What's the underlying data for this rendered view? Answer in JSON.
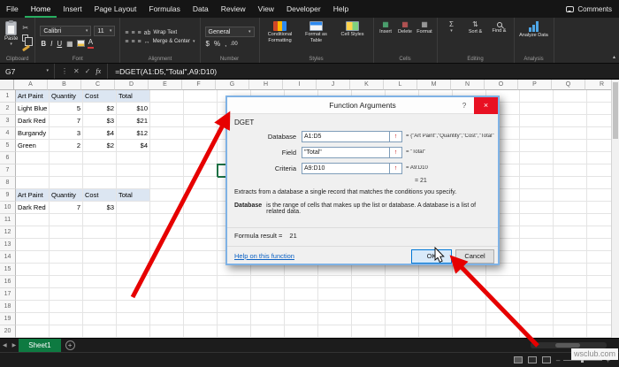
{
  "icons": {
    "dropdown": "▾",
    "close_x": "×",
    "check": "✓",
    "cancel_x": "✕",
    "fx": "fx",
    "kebab": "⋮",
    "scissors": "✂",
    "sigma": "Σ",
    "align_lines": "≡",
    "dollar": "$",
    "percent": "%",
    "comma": ",",
    "decimals": ".00",
    "bold": "B",
    "italic": "I",
    "underline": "U",
    "borders": "▦",
    "merge_arrows": "↔",
    "wrap_ab": "ab",
    "font_color_a": "A",
    "insert_glyph": "▦",
    "delete_glyph": "▦",
    "format_glyph": "▦",
    "sort_arrows": "⇅",
    "range_arrow": "↑",
    "nav_left": "◀",
    "nav_right": "▶",
    "add_sheet": "+",
    "collapse_ribbon": "▴",
    "help_q": "?",
    "zoom_minus": "–",
    "zoom_plus": "+"
  },
  "ribbon": {
    "tabs": [
      {
        "label": "File",
        "active": false
      },
      {
        "label": "Home",
        "active": true
      },
      {
        "label": "Insert",
        "active": false
      },
      {
        "label": "Page Layout",
        "active": false
      },
      {
        "label": "Formulas",
        "active": false
      },
      {
        "label": "Data",
        "active": false
      },
      {
        "label": "Review",
        "active": false
      },
      {
        "label": "View",
        "active": false
      },
      {
        "label": "Developer",
        "active": false
      },
      {
        "label": "Help",
        "active": false
      }
    ],
    "comments_label": "Comments",
    "clipboard": {
      "label": "Clipboard",
      "paste": "Paste"
    },
    "font": {
      "label": "Font",
      "family": "Calibri",
      "size": "11"
    },
    "alignment": {
      "label": "Alignment",
      "wrap": "Wrap Text",
      "merge": "Merge & Center"
    },
    "number": {
      "label": "Number",
      "format": "General"
    },
    "styles": {
      "label": "Styles",
      "conditional": "Conditional Formatting",
      "table": "Format as Table",
      "cellstyles": "Cell Styles"
    },
    "cells": {
      "label": "Cells",
      "insert": "Insert",
      "delete": "Delete",
      "format": "Format"
    },
    "editing": {
      "label": "Editing",
      "sort": "Sort &",
      "find": "Find &"
    },
    "analysis": {
      "label": "Analysis",
      "analyze": "Analyze Data"
    }
  },
  "formula_bar": {
    "name_box": "G7",
    "formula": "=DGET(A1:D5,\"Total\",A9:D10)"
  },
  "sheet": {
    "col_headers": [
      "A",
      "B",
      "C",
      "D",
      "E",
      "F",
      "G",
      "H",
      "I",
      "J",
      "K",
      "L",
      "M",
      "N",
      "O",
      "P",
      "Q",
      "R"
    ],
    "row_count": 20,
    "header_fill_rows": [
      1,
      9
    ],
    "active_cell": {
      "col": "G",
      "row": 7
    },
    "cells": {
      "1": {
        "A": "Art Paint",
        "B": "Quantity",
        "C": "Cost",
        "D": "Total"
      },
      "2": {
        "A": "Light Blue",
        "B": "5",
        "C": "$2",
        "D": "$10"
      },
      "3": {
        "A": "Dark Red",
        "B": "7",
        "C": "$3",
        "D": "$21"
      },
      "4": {
        "A": "Burgandy",
        "B": "3",
        "C": "$4",
        "D": "$12"
      },
      "5": {
        "A": "Green",
        "B": "2",
        "C": "$2",
        "D": "$4"
      },
      "9": {
        "A": "Art Paint",
        "B": "Quantity",
        "C": "Cost",
        "D": "Total"
      },
      "10": {
        "A": "Dark Red",
        "B": "7",
        "C": "$3"
      }
    }
  },
  "dialog": {
    "title": "Function Arguments",
    "function_name": "DGET",
    "args": [
      {
        "label": "Database",
        "value": "A1:D5",
        "result": "= {\"Art Paint\",\"Quantity\",\"Cost\",\"Total\";..."
      },
      {
        "label": "Field",
        "value": "\"Total\"",
        "result": "= \"Total\""
      },
      {
        "label": "Criteria",
        "value": "A9:D10",
        "result": "= A9:D10"
      }
    ],
    "overall_result": "= 21",
    "description": "Extracts from a database a single record that matches the conditions you specify.",
    "arg_help_name": "Database",
    "arg_help_text": "is the range of cells that makes up the list or database. A database is a list of related data.",
    "formula_result_label": "Formula result =",
    "formula_result_value": "21",
    "help_link": "Help on this function",
    "ok_label": "OK",
    "cancel_label": "Cancel"
  },
  "sheet_tabs": {
    "active": "Sheet1"
  },
  "watermark": "wsclub.com"
}
